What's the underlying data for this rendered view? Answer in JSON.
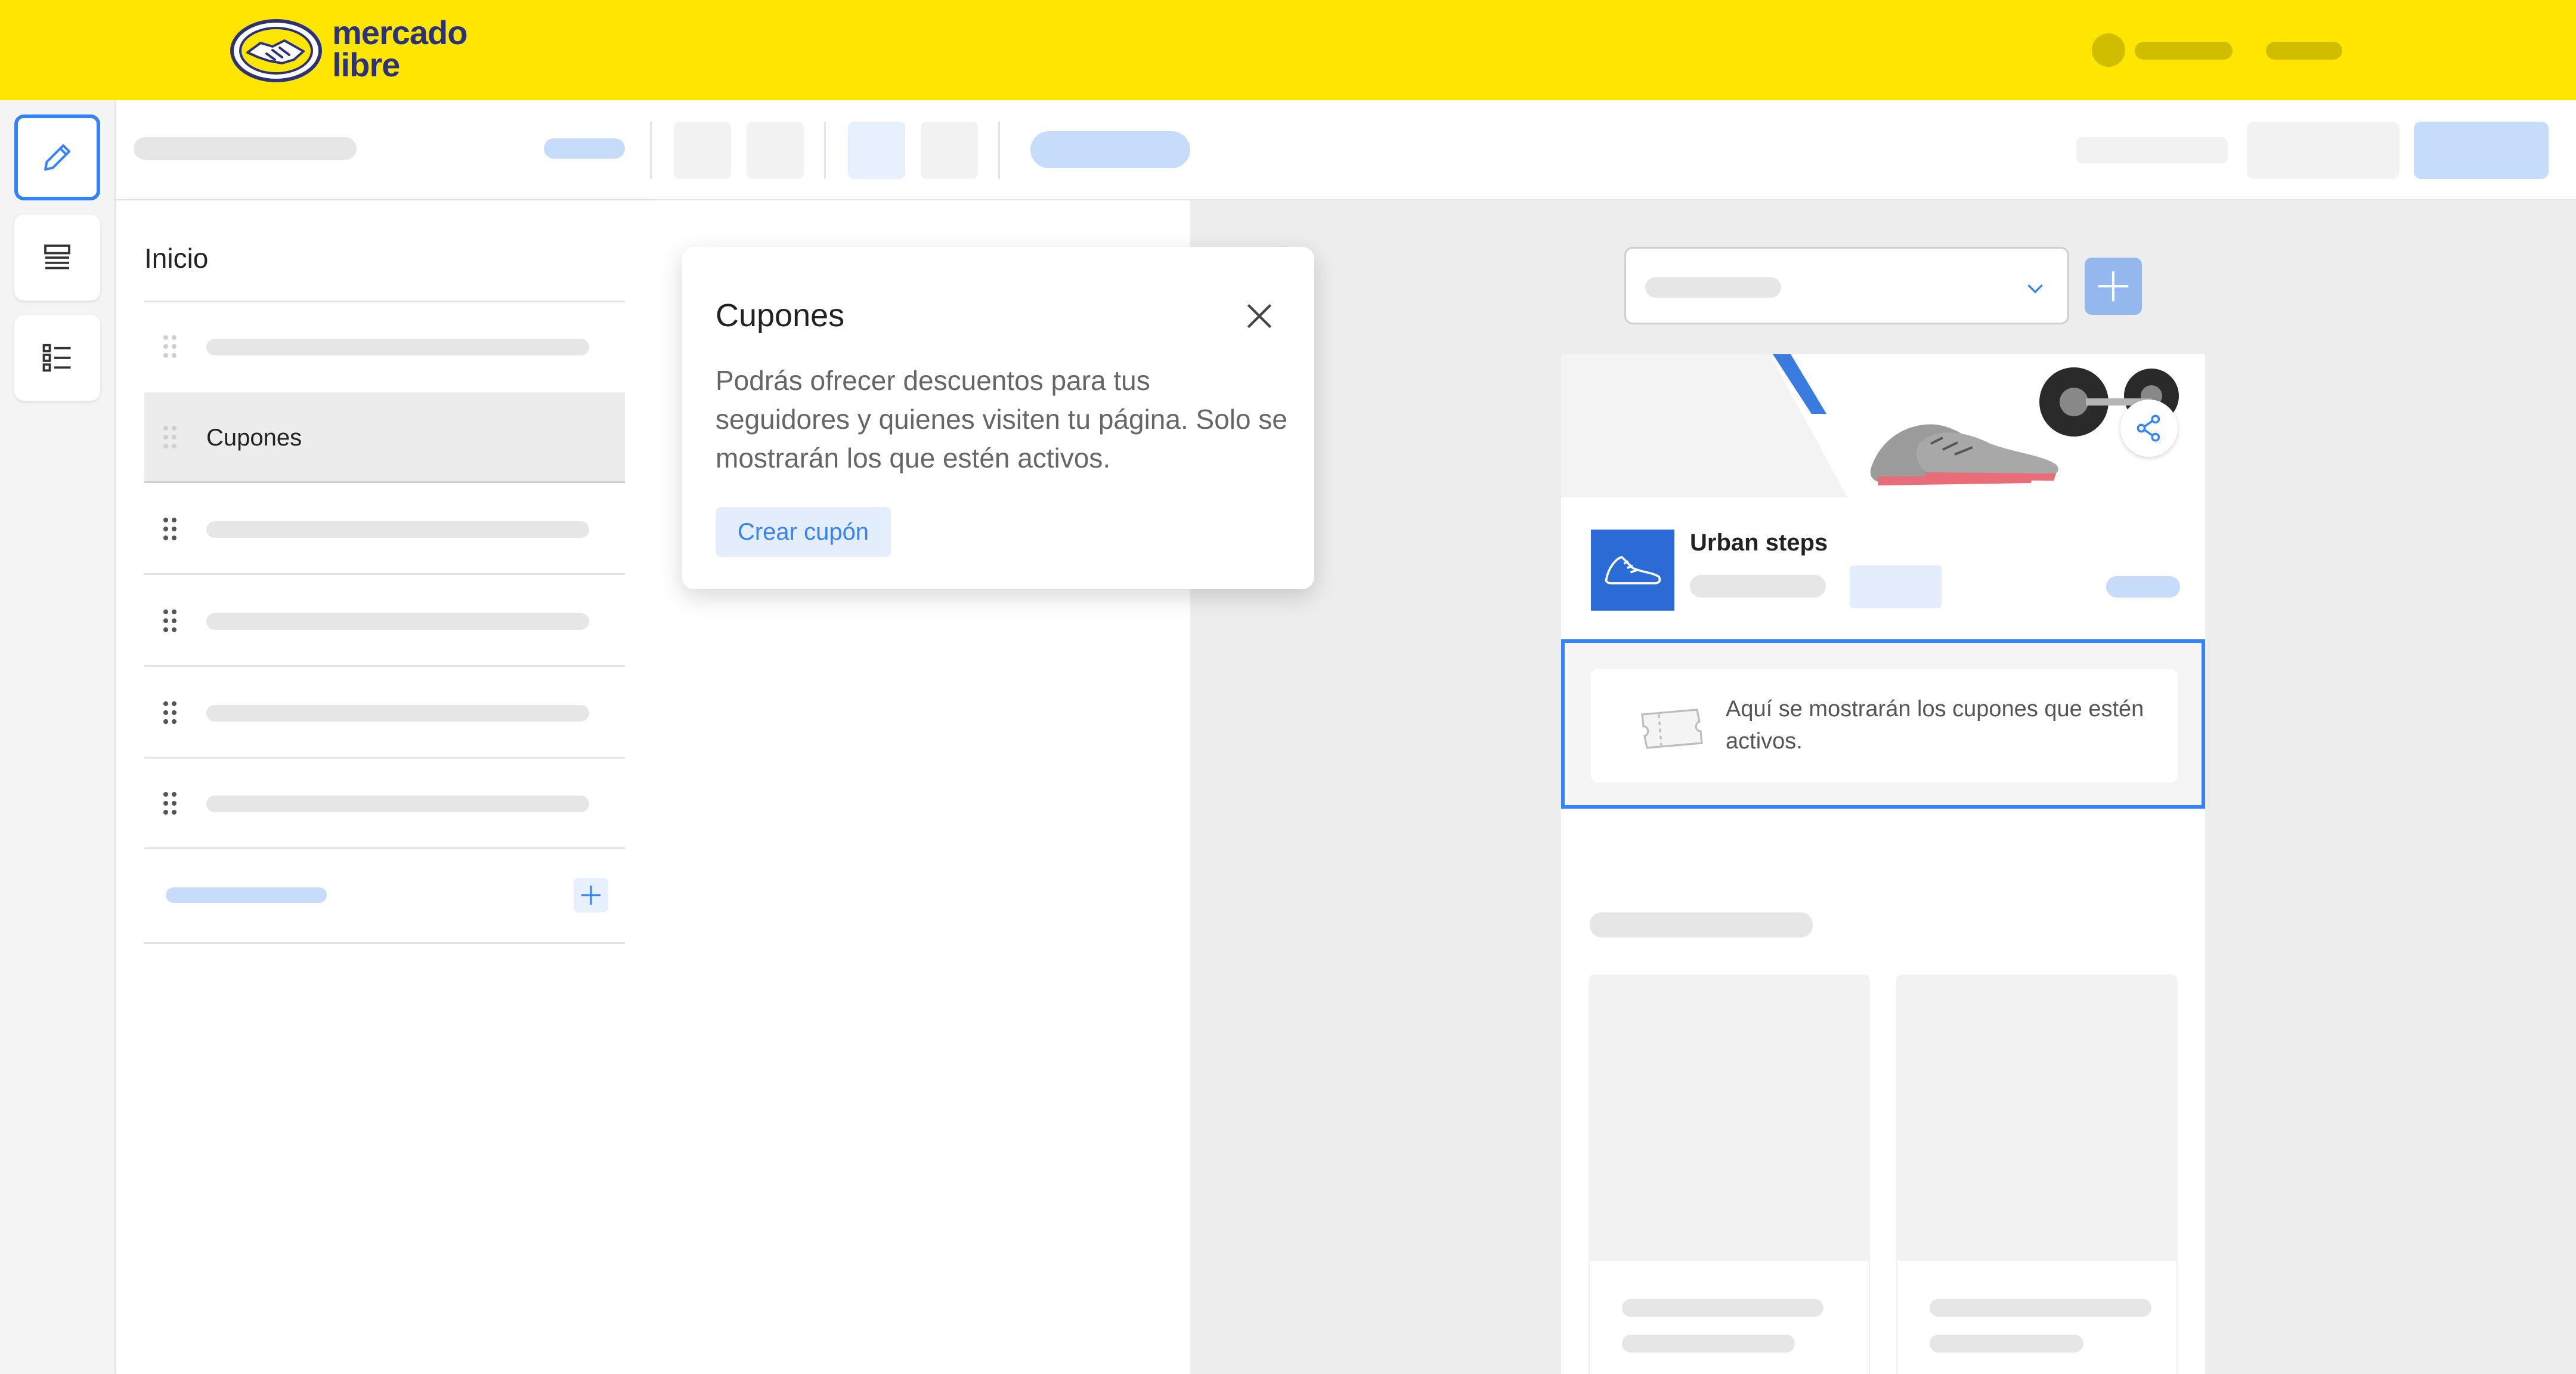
{
  "header": {
    "logo_text": "mercado\nlibre",
    "brand_color": "#ffe600",
    "logo_text_color": "#2d3277"
  },
  "rail": {
    "items": [
      {
        "icon": "pencil-icon",
        "active": true
      },
      {
        "icon": "sections-icon",
        "active": false
      },
      {
        "icon": "list-icon",
        "active": false
      }
    ]
  },
  "sections": {
    "title": "Inicio",
    "selected_label": "Cupones"
  },
  "popover": {
    "title": "Cupones",
    "body": "Podrás ofrecer descuentos para tus seguidores y quienes visiten tu página. Solo se mostrarán los que estén activos.",
    "button_label": "Crear cupón",
    "close_icon": "close-icon"
  },
  "preview": {
    "store_name": "Urban steps",
    "coupon_empty_text": "Aquí se mostrarán los cupones que estén activos.",
    "accent_color": "#3483fa"
  }
}
